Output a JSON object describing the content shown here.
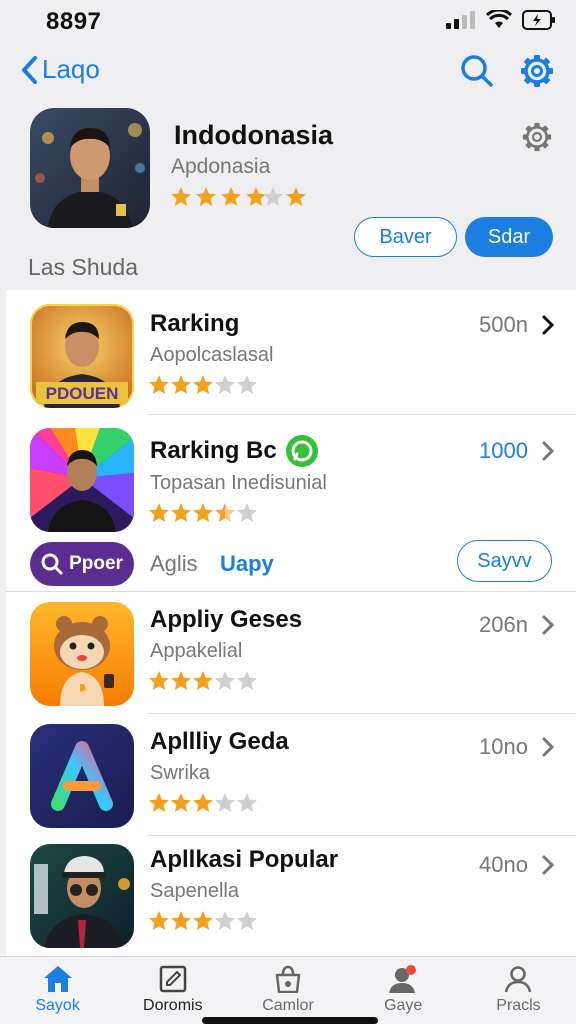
{
  "status": {
    "time": "8897"
  },
  "nav": {
    "back_label": "Laqo"
  },
  "hero": {
    "title": "Indodonasia",
    "subtitle": "Apdonasia",
    "rating": 3.5,
    "btn_outline": "Baver",
    "btn_fill": "Sdar"
  },
  "section_label": "Las Shuda",
  "rows": [
    {
      "title": "Rarking",
      "subtitle": "Aopolcaslasal",
      "meta": "500n",
      "rating": 3,
      "thumb_text": "PDOUEN"
    },
    {
      "title": "Rarking Bc",
      "subtitle": "Topasan Inedisunial",
      "meta": "1000",
      "rating": 3.5
    },
    {
      "title": "Appliy Geses",
      "subtitle": "Appakelial",
      "meta": "206n",
      "rating": 3
    },
    {
      "title": "Apllliy Geda",
      "subtitle": "Swrika",
      "meta": "10no",
      "rating": 3
    },
    {
      "title": "Apllkasi Popular",
      "subtitle": "Sapenella",
      "meta": "40no",
      "rating": 3
    }
  ],
  "promo": {
    "pill": "Ppoer",
    "text1": "Aglis",
    "text2": "Uapy",
    "button": "Sayvv"
  },
  "tabs": [
    {
      "label": "Sayok",
      "icon": "home-icon"
    },
    {
      "label": "Doromis",
      "icon": "edit-icon"
    },
    {
      "label": "Camlor",
      "icon": "bag-icon"
    },
    {
      "label": "Gaye",
      "icon": "person-badge-icon"
    },
    {
      "label": "Pracls",
      "icon": "profile-icon"
    }
  ],
  "colors": {
    "accent": "#1a7fe0",
    "star": "#f2a11f",
    "star_empty": "#cfcfcf",
    "badge": "#34c038",
    "promo_pill": "#5b2d91"
  }
}
